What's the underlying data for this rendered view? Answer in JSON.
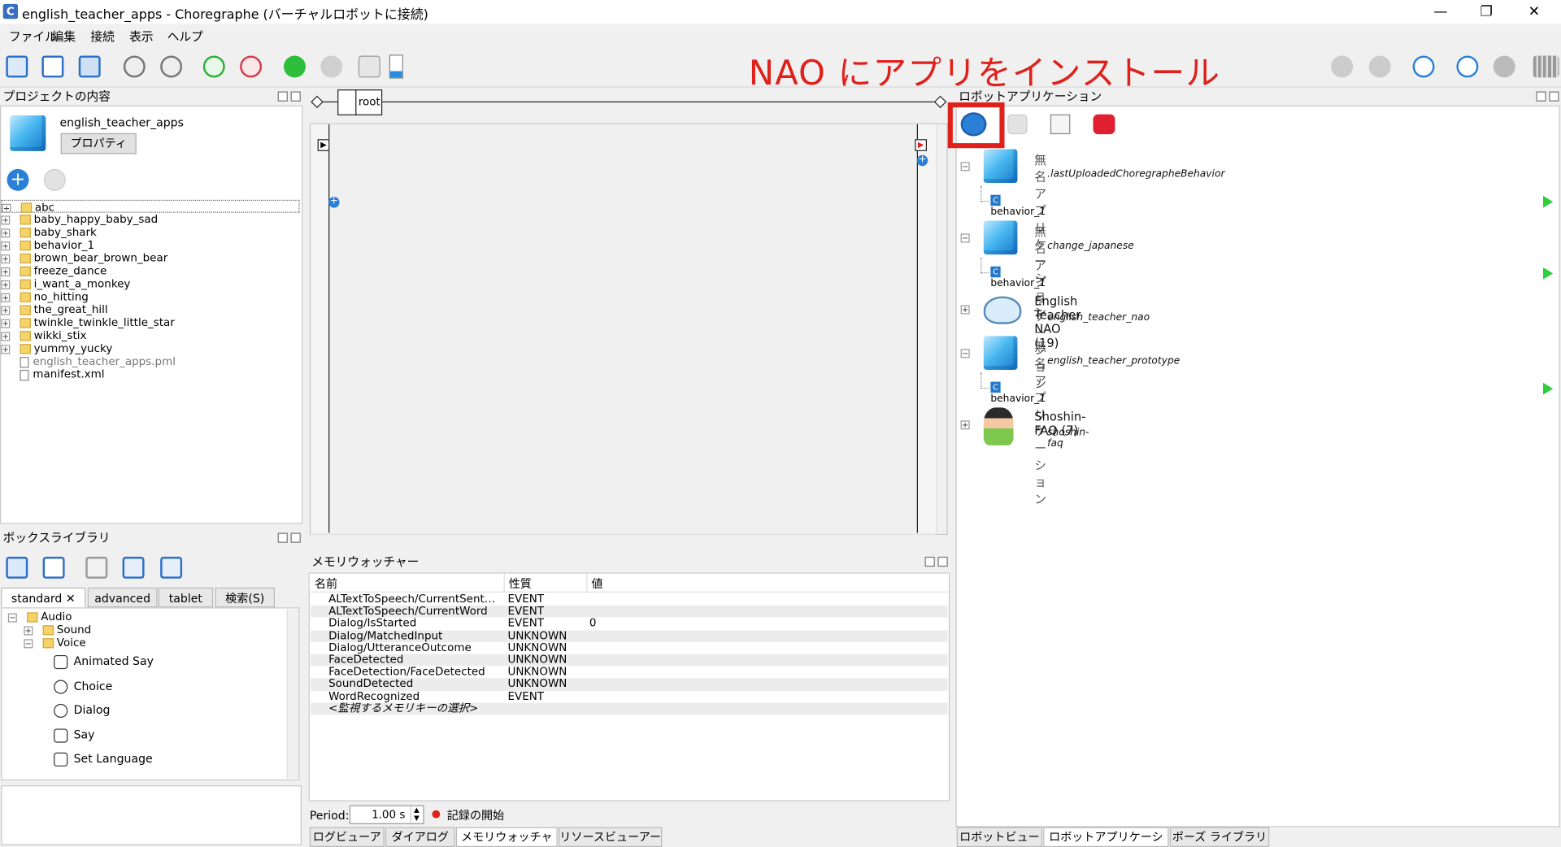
{
  "window": {
    "title": "english_teacher_apps - Choregraphe (バーチャルロボットに接続)",
    "app_icon_letter": "C",
    "minimize": "—",
    "maximize": "❐",
    "close": "✕"
  },
  "menu": [
    "ファイル",
    "編集",
    "接続",
    "表示",
    "ヘルプ"
  ],
  "annotation": "NAO にアプリをインストール",
  "project_panel": {
    "title": "プロジェクトの内容",
    "project_name": "english_teacher_apps",
    "properties_button": "プロパティ",
    "items": [
      {
        "name": "abc",
        "type": "folder"
      },
      {
        "name": "baby_happy_baby_sad",
        "type": "folder"
      },
      {
        "name": "baby_shark",
        "type": "folder"
      },
      {
        "name": "behavior_1",
        "type": "folder"
      },
      {
        "name": "brown_bear_brown_bear",
        "type": "folder"
      },
      {
        "name": "freeze_dance",
        "type": "folder"
      },
      {
        "name": "i_want_a_monkey",
        "type": "folder"
      },
      {
        "name": "no_hitting",
        "type": "folder"
      },
      {
        "name": "the_great_hill",
        "type": "folder"
      },
      {
        "name": "twinkle_twinkle_little_star",
        "type": "folder"
      },
      {
        "name": "wikki_stix",
        "type": "folder"
      },
      {
        "name": "yummy_yucky",
        "type": "folder"
      },
      {
        "name": "english_teacher_apps.pml",
        "type": "file"
      },
      {
        "name": "manifest.xml",
        "type": "file"
      }
    ]
  },
  "flow": {
    "root_label": "root"
  },
  "box_library": {
    "title": "ボックスライブラリ",
    "tabs": [
      "standard",
      "advanced",
      "tablet",
      "検索(S)"
    ],
    "tab_close": "✕",
    "tree": {
      "audio": "Audio",
      "sound": "Sound",
      "voice": "Voice"
    },
    "items": [
      "Animated Say",
      "Choice",
      "Dialog",
      "Say",
      "Set Language"
    ]
  },
  "memory_watcher": {
    "title": "メモリウォッチャー",
    "columns": [
      "名前",
      "性質",
      "値"
    ],
    "rows": [
      {
        "name": "ALTextToSpeech/CurrentSent…",
        "type": "EVENT",
        "value": ""
      },
      {
        "name": "ALTextToSpeech/CurrentWord",
        "type": "EVENT",
        "value": ""
      },
      {
        "name": "Dialog/IsStarted",
        "type": "EVENT",
        "value": "0"
      },
      {
        "name": "Dialog/MatchedInput",
        "type": "UNKNOWN",
        "value": ""
      },
      {
        "name": "Dialog/UtteranceOutcome",
        "type": "UNKNOWN",
        "value": ""
      },
      {
        "name": "FaceDetected",
        "type": "UNKNOWN",
        "value": ""
      },
      {
        "name": "FaceDetection/FaceDetected",
        "type": "UNKNOWN",
        "value": ""
      },
      {
        "name": "SoundDetected",
        "type": "UNKNOWN",
        "value": ""
      },
      {
        "name": "WordRecognized",
        "type": "EVENT",
        "value": ""
      },
      {
        "name": "<監視するメモリキーの選択>",
        "type": "",
        "value": ""
      }
    ],
    "period_label": "Period:",
    "period_value": "1.00 s",
    "record_label": "記録の開始"
  },
  "bottom_tabs_center": [
    "ログビューア",
    "ダイアログ",
    "メモリウォッチャー",
    "リソースビューアー"
  ],
  "robot_apps": {
    "title": "ロボットアプリケーション",
    "apps": [
      {
        "title": "無名アプリケーション",
        "id": ".lastUploadedChoregrapheBehavior",
        "behavior": "behavior_1",
        "icon": "cube"
      },
      {
        "title": "無名アプリケーション",
        "id": "change_japanese",
        "behavior": "behavior_1",
        "icon": "cube"
      },
      {
        "title": "English Teacher NAO (19)",
        "id": "english_teacher_nao",
        "behavior": "",
        "icon": "nao"
      },
      {
        "title": "無名アプリケーション",
        "id": "english_teacher_prototype",
        "behavior": "behavior_1",
        "icon": "cube"
      },
      {
        "title": "Shoshin-FAQ (7)",
        "id": "shoshin-faq",
        "behavior": "",
        "icon": "person"
      }
    ]
  },
  "bottom_tabs_right": [
    "ロボットビュー",
    "ロボットアプリケーション",
    "ポーズ ライブラリ"
  ],
  "colors": {
    "annotation": "#e0201a",
    "highlight_box": "#e0201a",
    "play": "#2dcf3a",
    "accent": "#2478c8"
  }
}
